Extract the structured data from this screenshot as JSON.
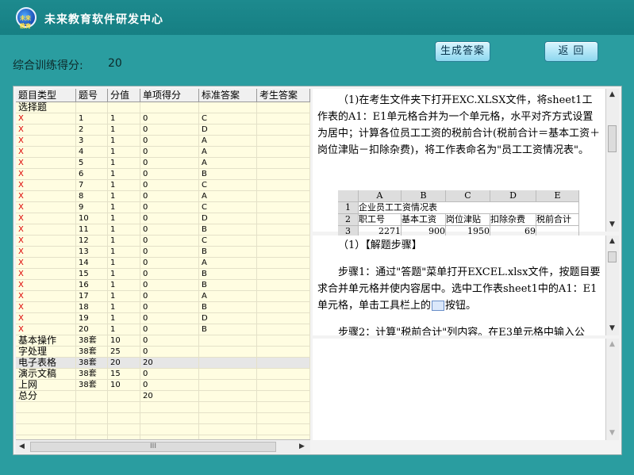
{
  "app": {
    "title": "未来教育软件研发中心",
    "logo_text": "未来教育"
  },
  "toolbar": {
    "generate_label": "生成答案",
    "back_label": "返  回"
  },
  "score": {
    "label": "综合训练得分:",
    "value": "20"
  },
  "table": {
    "headers": [
      "题目类型",
      "题号",
      "分值",
      "单项得分",
      "标准答案",
      "考生答案"
    ],
    "rows": [
      [
        "选择题",
        "",
        "",
        "",
        "",
        ""
      ],
      [
        "X",
        "1",
        "1",
        "0",
        "C",
        ""
      ],
      [
        "X",
        "2",
        "1",
        "0",
        "D",
        ""
      ],
      [
        "X",
        "3",
        "1",
        "0",
        "A",
        ""
      ],
      [
        "X",
        "4",
        "1",
        "0",
        "A",
        ""
      ],
      [
        "X",
        "5",
        "1",
        "0",
        "A",
        ""
      ],
      [
        "X",
        "6",
        "1",
        "0",
        "B",
        ""
      ],
      [
        "X",
        "7",
        "1",
        "0",
        "C",
        ""
      ],
      [
        "X",
        "8",
        "1",
        "0",
        "A",
        ""
      ],
      [
        "X",
        "9",
        "1",
        "0",
        "C",
        ""
      ],
      [
        "X",
        "10",
        "1",
        "0",
        "D",
        ""
      ],
      [
        "X",
        "11",
        "1",
        "0",
        "B",
        ""
      ],
      [
        "X",
        "12",
        "1",
        "0",
        "C",
        ""
      ],
      [
        "X",
        "13",
        "1",
        "0",
        "B",
        ""
      ],
      [
        "X",
        "14",
        "1",
        "0",
        "A",
        ""
      ],
      [
        "X",
        "15",
        "1",
        "0",
        "B",
        ""
      ],
      [
        "X",
        "16",
        "1",
        "0",
        "B",
        ""
      ],
      [
        "X",
        "17",
        "1",
        "0",
        "A",
        ""
      ],
      [
        "X",
        "18",
        "1",
        "0",
        "B",
        ""
      ],
      [
        "X",
        "19",
        "1",
        "0",
        "D",
        ""
      ],
      [
        "X",
        "20",
        "1",
        "0",
        "B",
        ""
      ],
      [
        "基本操作",
        "38套",
        "10",
        "0",
        "",
        ""
      ],
      [
        "字处理",
        "38套",
        "25",
        "0",
        "",
        ""
      ],
      [
        "电子表格",
        "38套",
        "20",
        "20",
        "",
        ""
      ],
      [
        "演示文稿",
        "38套",
        "15",
        "0",
        "",
        ""
      ],
      [
        "上网",
        "38套",
        "10",
        "0",
        "",
        ""
      ],
      [
        "总分",
        "",
        "",
        "20",
        "",
        ""
      ]
    ],
    "selected_row": 23,
    "scroll_mid": "III"
  },
  "question": {
    "text": "（1)在考生文件夹下打开EXC.XLSX文件，将sheet1工作表的A1：E1单元格合并为一个单元格，水平对齐方式设置为居中；计算各位员工工资的税前合计(税前合计＝基本工资＋岗位津贴－扣除杂费)，将工作表命名为\"员工工资情况表\"。",
    "excel_headers": [
      "",
      "A",
      "B",
      "C",
      "D",
      "E"
    ],
    "excel_rows": [
      [
        "1",
        "企业员工工资情况表",
        "",
        "",
        "",
        ""
      ],
      [
        "2",
        "职工号",
        "基本工资",
        "岗位津贴",
        "扣除杂费",
        "税前合计"
      ],
      [
        "3",
        "2271",
        "900",
        "1950",
        "69",
        ""
      ]
    ]
  },
  "steps": {
    "heading": "（1）【解题步骤】",
    "step1_a": "步骤1：通过\"答题\"菜单打开EXCEL.xlsx文件，按题目要求合并单元格并使内容居中。选中工作表sheet1中的A1：E1单元格，单击工具栏上的",
    "step1_b": "按钮。",
    "step2": "步骤2：计算\"税前合计\"列内容。在E3单元格中输入公"
  },
  "colors": {
    "background": "#2a9da0",
    "title_bar": "#1d8a8e",
    "table_bg": "#fffde1",
    "wrong_mark": "#dd0000"
  }
}
